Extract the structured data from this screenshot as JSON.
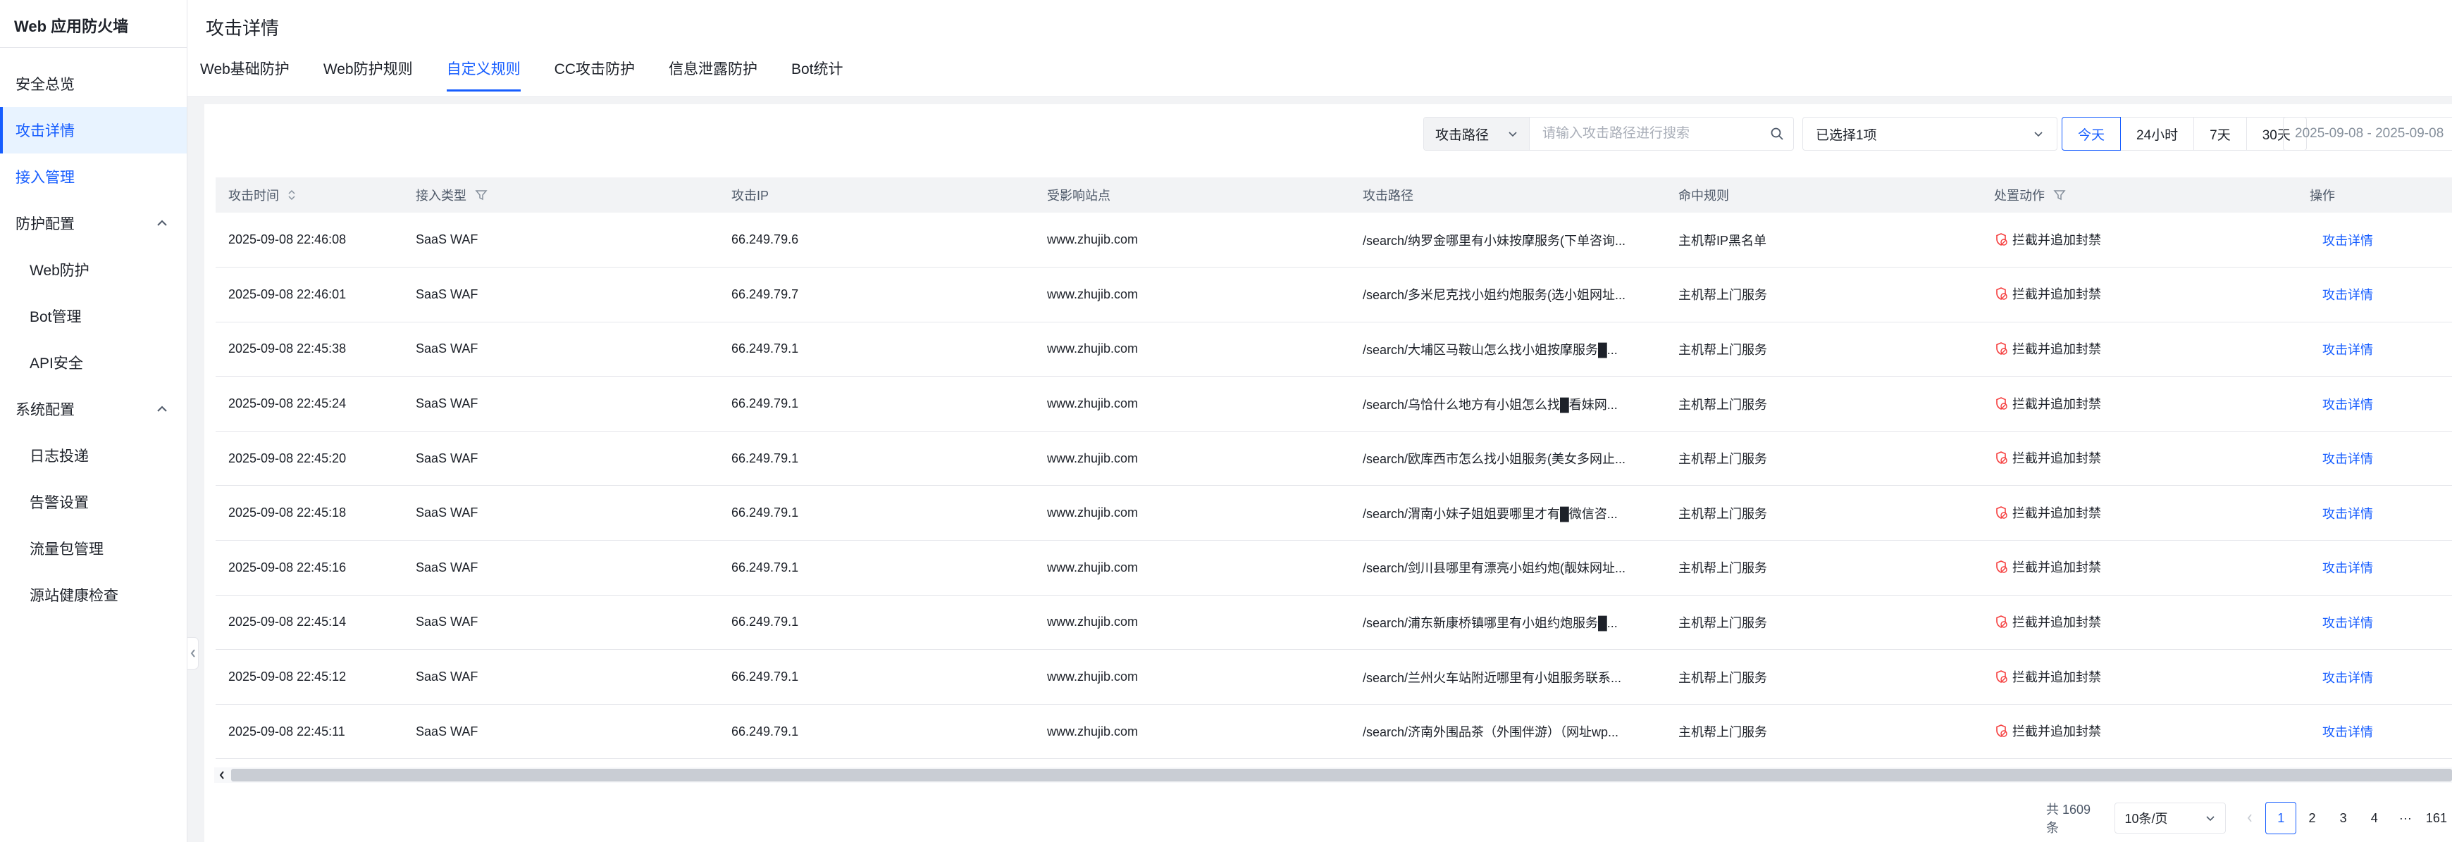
{
  "sidebar": {
    "brand": "Web 应用防火墙",
    "items": [
      {
        "label": "安全总览",
        "state": "normal"
      },
      {
        "label": "攻击详情",
        "state": "active"
      },
      {
        "label": "接入管理",
        "state": "link"
      },
      {
        "label": "防护配置",
        "state": "group"
      },
      {
        "label": "Web防护",
        "state": "sub"
      },
      {
        "label": "Bot管理",
        "state": "sub"
      },
      {
        "label": "API安全",
        "state": "sub"
      },
      {
        "label": "系统配置",
        "state": "group"
      },
      {
        "label": "日志投递",
        "state": "sub"
      },
      {
        "label": "告警设置",
        "state": "sub"
      },
      {
        "label": "流量包管理",
        "state": "sub"
      },
      {
        "label": "源站健康检查",
        "state": "sub"
      }
    ]
  },
  "header": {
    "title": "攻击详情",
    "tabs": [
      "Web基础防护",
      "Web防护规则",
      "自定义规则",
      "CC攻击防护",
      "信息泄露防护",
      "Bot统计"
    ],
    "active_tab": "自定义规则"
  },
  "toolbar": {
    "search_field": "攻击路径",
    "search_placeholder": "请输入攻击路径进行搜索",
    "multi_select": "已选择1项",
    "ranges": [
      "今天",
      "24小时",
      "7天",
      "30天"
    ],
    "active_range": "今天",
    "date_range": "2025-09-08 - 2025-09-08"
  },
  "table": {
    "columns": [
      "攻击时间",
      "接入类型",
      "攻击IP",
      "受影响站点",
      "攻击路径",
      "命中规则",
      "处置动作",
      "操作"
    ],
    "rows": [
      {
        "time": "2025-09-08 22:46:08",
        "type": "SaaS WAF",
        "ip": "66.249.79.6",
        "site": "www.zhujib.com",
        "path": "/search/纳罗金哪里有小妹按摩服务(下单咨询...",
        "rule": "主机帮IP黑名单",
        "action": "拦截并追加封禁",
        "op": "攻击详情"
      },
      {
        "time": "2025-09-08 22:46:01",
        "type": "SaaS WAF",
        "ip": "66.249.79.7",
        "site": "www.zhujib.com",
        "path": "/search/多米尼克找小姐约炮服务(选小姐网址...",
        "rule": "主机帮上门服务",
        "action": "拦截并追加封禁",
        "op": "攻击详情"
      },
      {
        "time": "2025-09-08 22:45:38",
        "type": "SaaS WAF",
        "ip": "66.249.79.1",
        "site": "www.zhujib.com",
        "path": "/search/大埔区马鞍山怎么找小姐按摩服务█...",
        "rule": "主机帮上门服务",
        "action": "拦截并追加封禁",
        "op": "攻击详情"
      },
      {
        "time": "2025-09-08 22:45:24",
        "type": "SaaS WAF",
        "ip": "66.249.79.1",
        "site": "www.zhujib.com",
        "path": "/search/乌恰什么地方有小姐怎么找█看妹网...",
        "rule": "主机帮上门服务",
        "action": "拦截并追加封禁",
        "op": "攻击详情"
      },
      {
        "time": "2025-09-08 22:45:20",
        "type": "SaaS WAF",
        "ip": "66.249.79.1",
        "site": "www.zhujib.com",
        "path": "/search/欧库西市怎么找小姐服务(美女多网止...",
        "rule": "主机帮上门服务",
        "action": "拦截并追加封禁",
        "op": "攻击详情"
      },
      {
        "time": "2025-09-08 22:45:18",
        "type": "SaaS WAF",
        "ip": "66.249.79.1",
        "site": "www.zhujib.com",
        "path": "/search/渭南小妹子姐姐要哪里才有█微信咨...",
        "rule": "主机帮上门服务",
        "action": "拦截并追加封禁",
        "op": "攻击详情"
      },
      {
        "time": "2025-09-08 22:45:16",
        "type": "SaaS WAF",
        "ip": "66.249.79.1",
        "site": "www.zhujib.com",
        "path": "/search/剑川县哪里有漂亮小姐约炮(靓妹网址...",
        "rule": "主机帮上门服务",
        "action": "拦截并追加封禁",
        "op": "攻击详情"
      },
      {
        "time": "2025-09-08 22:45:14",
        "type": "SaaS WAF",
        "ip": "66.249.79.1",
        "site": "www.zhujib.com",
        "path": "/search/浦东新康桥镇哪里有小姐约炮服务█...",
        "rule": "主机帮上门服务",
        "action": "拦截并追加封禁",
        "op": "攻击详情"
      },
      {
        "time": "2025-09-08 22:45:12",
        "type": "SaaS WAF",
        "ip": "66.249.79.1",
        "site": "www.zhujib.com",
        "path": "/search/兰州火车站附近哪里有小姐服务联系...",
        "rule": "主机帮上门服务",
        "action": "拦截并追加封禁",
        "op": "攻击详情"
      },
      {
        "time": "2025-09-08 22:45:11",
        "type": "SaaS WAF",
        "ip": "66.249.79.1",
        "site": "www.zhujib.com",
        "path": "/search/济南外围品茶（外围伴游）（网址wp...",
        "rule": "主机帮上门服务",
        "action": "拦截并追加封禁",
        "op": "攻击详情"
      }
    ]
  },
  "pagination": {
    "total": "共 1609 条",
    "page_size": "10条/页",
    "pages": [
      "1",
      "2",
      "3",
      "4"
    ],
    "ellipsis": "···",
    "last": "161",
    "current": "1"
  },
  "colors": {
    "accent": "#165dff",
    "danger": "#f53f3f"
  }
}
